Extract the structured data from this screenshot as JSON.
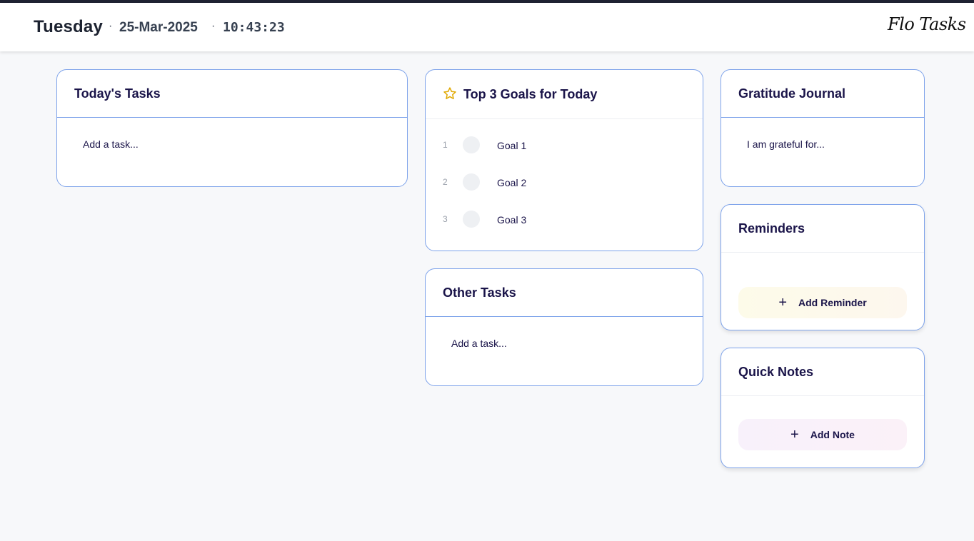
{
  "header": {
    "day": "Tuesday",
    "separator": "·",
    "date": "25-Mar-2025",
    "time": "10:43:23",
    "logo": "Flo Tasks"
  },
  "todays_tasks": {
    "title": "Today's Tasks",
    "placeholder": "Add a task..."
  },
  "top_goals": {
    "icon": "star-icon",
    "icon_color": "#e0a800",
    "title": "Top 3 Goals for Today",
    "goals": [
      {
        "number": "1",
        "label": "Goal 1"
      },
      {
        "number": "2",
        "label": "Goal 2"
      },
      {
        "number": "3",
        "label": "Goal 3"
      }
    ]
  },
  "other_tasks": {
    "title": "Other Tasks",
    "placeholder": "Add a task..."
  },
  "gratitude": {
    "title": "Gratitude Journal",
    "placeholder": "I am grateful for..."
  },
  "reminders": {
    "title": "Reminders",
    "add_label": "Add Reminder",
    "add_icon": "plus-icon"
  },
  "quick_notes": {
    "title": "Quick Notes",
    "add_label": "Add Note",
    "add_icon": "plus-icon"
  },
  "colors": {
    "accent_border": "#7ea3ea",
    "title_text": "#1a1449",
    "header_strip": "#1f2233"
  }
}
